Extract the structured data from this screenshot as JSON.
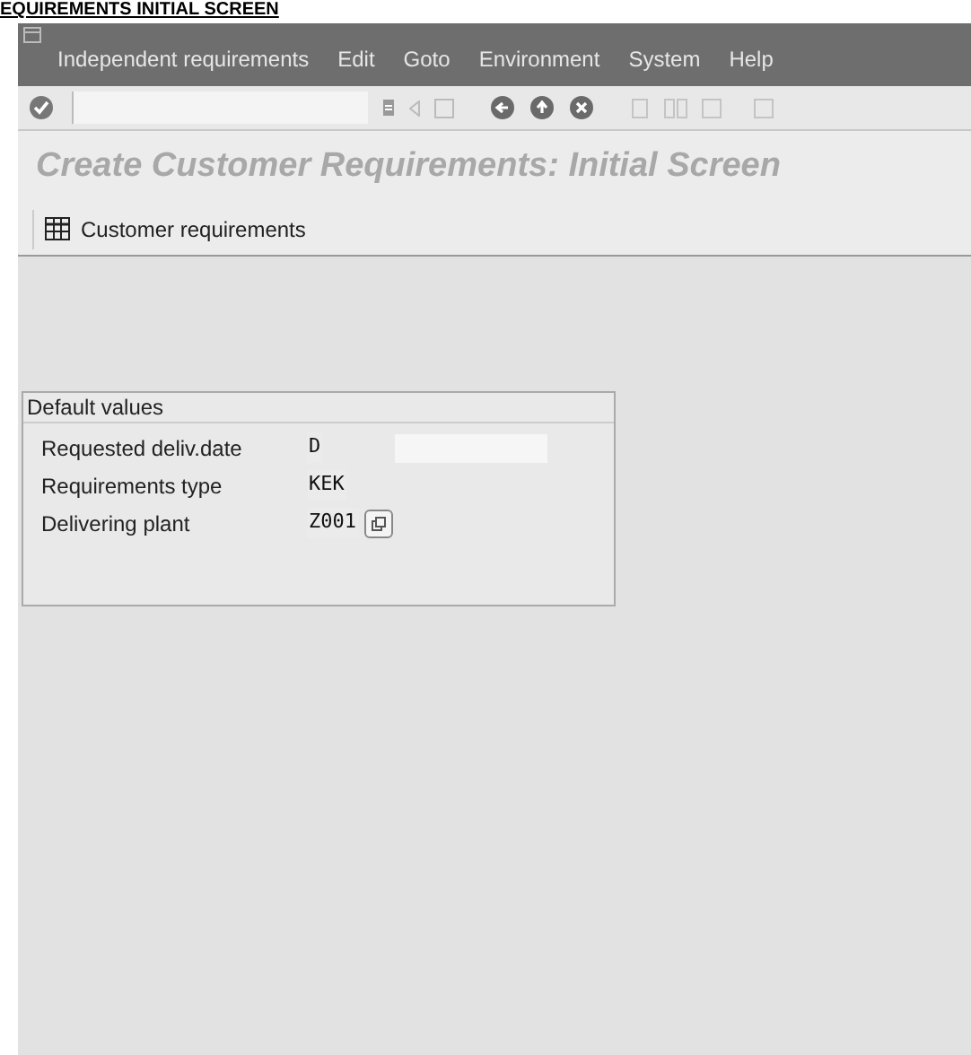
{
  "document_heading": "EQUIREMENTS INITIAL SCREEN",
  "menu_bar": [
    "Independent requirements",
    "Edit",
    "Goto",
    "Environment",
    "System",
    "Help"
  ],
  "screen_title": "Create Customer Requirements: Initial Screen",
  "app_toolbar": [
    {
      "label": "Customer requirements"
    }
  ],
  "group": {
    "title": "Default values",
    "fields": [
      {
        "label": "Requested deliv.date",
        "value": "D",
        "kind": "date"
      },
      {
        "label": "Requirements type",
        "value": "KEK",
        "kind": "plain"
      },
      {
        "label": "Delivering plant",
        "value": "Z001",
        "kind": "lookup"
      }
    ]
  }
}
